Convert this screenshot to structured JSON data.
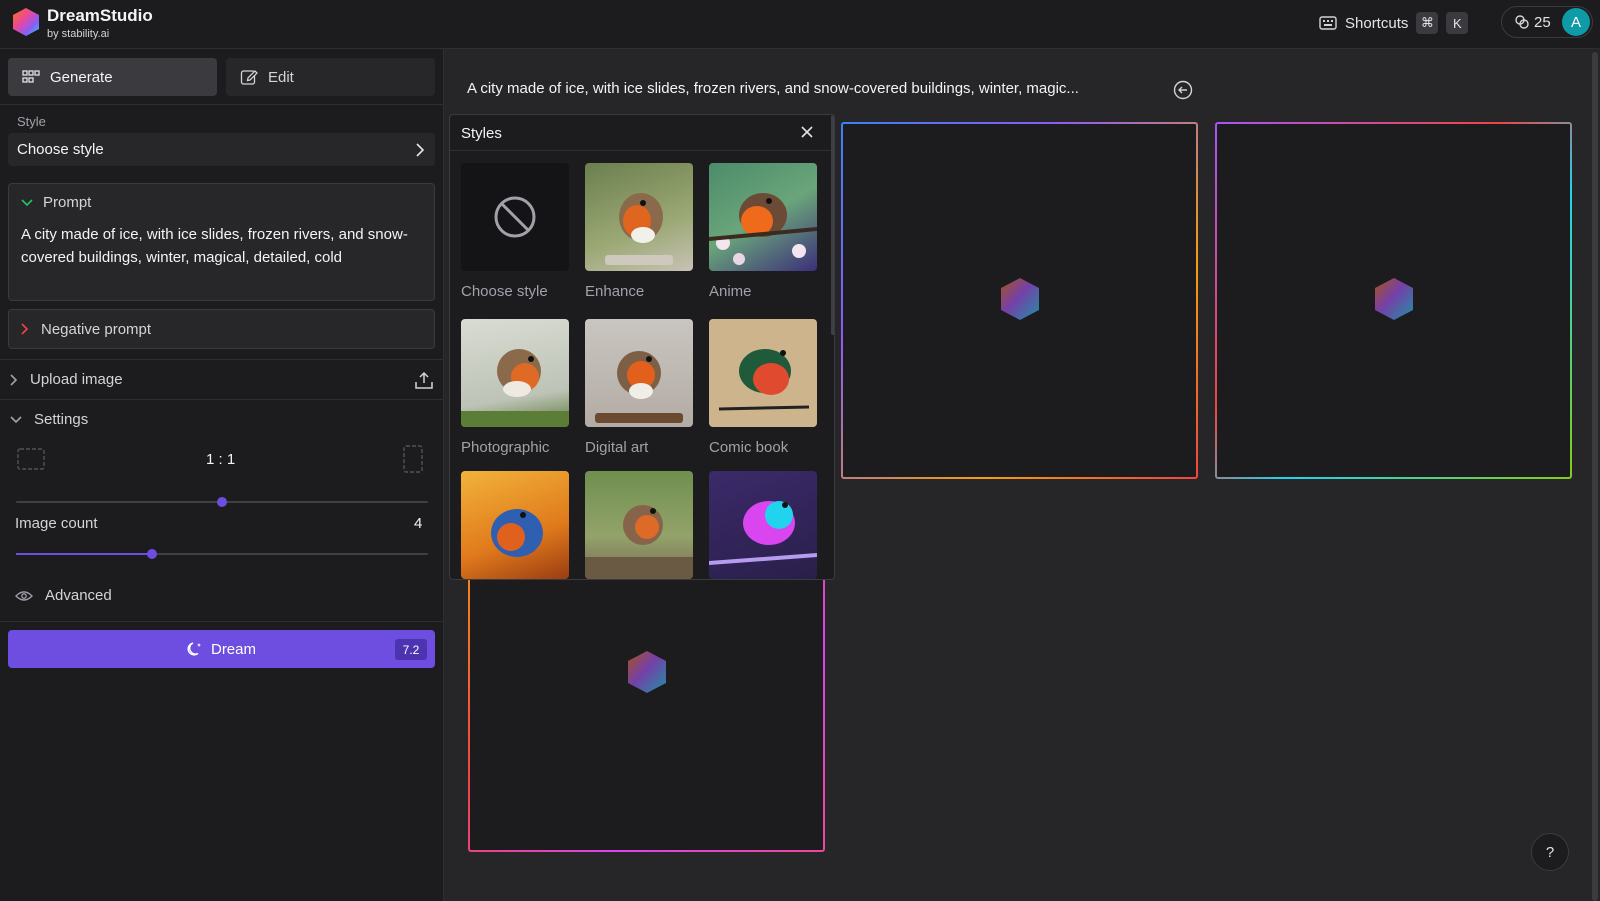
{
  "header": {
    "brand": "DreamStudio",
    "brand_sub": "by stability.ai",
    "shortcuts_label": "Shortcuts",
    "kbd_cmd": "⌘",
    "kbd_key": "K",
    "credits": "25",
    "avatar_letter": "A"
  },
  "sidebar": {
    "tabs": [
      {
        "label": "Generate"
      },
      {
        "label": "Edit"
      }
    ],
    "style_label": "Style",
    "style_value": "Choose style",
    "prompt_label": "Prompt",
    "prompt_text": "A city made of ice, with ice slides, frozen rivers, and snow-covered buildings, winter, magical, detailed, cold",
    "negative_label": "Negative prompt",
    "upload_label": "Upload image",
    "settings_label": "Settings",
    "aspect_ratio": "1 : 1",
    "aspect_slider_fraction": 0.5,
    "image_count_label": "Image count",
    "image_count": "4",
    "image_count_fraction": 0.33,
    "advanced_label": "Advanced",
    "dream_label": "Dream",
    "dream_cost": "7.2"
  },
  "main": {
    "prompt_preview": "A city made of ice, with ice slides, frozen rivers, and snow-covered buildings, winter, magic..."
  },
  "styles_popup": {
    "title": "Styles",
    "items": [
      {
        "label": "Choose style"
      },
      {
        "label": "Enhance"
      },
      {
        "label": "Anime"
      },
      {
        "label": "Photographic"
      },
      {
        "label": "Digital art"
      },
      {
        "label": "Comic book"
      }
    ]
  },
  "help_label": "?",
  "colors": {
    "accent": "#6d4ee0",
    "panel": "#1c1c1f",
    "background": "#262629"
  }
}
